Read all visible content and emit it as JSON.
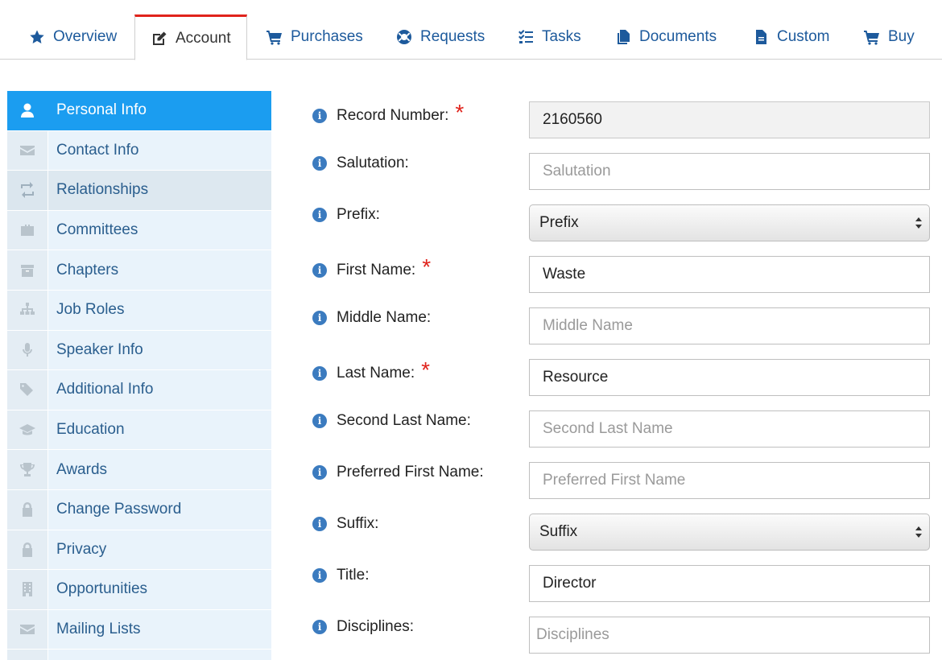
{
  "tabs": [
    {
      "label": "Overview",
      "icon": "star-icon"
    },
    {
      "label": "Account",
      "icon": "edit-icon",
      "active": true
    },
    {
      "label": "Purchases",
      "icon": "cart-icon"
    },
    {
      "label": "Requests",
      "icon": "lifebuoy-icon"
    },
    {
      "label": "Tasks",
      "icon": "tasks-icon"
    },
    {
      "label": "Documents",
      "icon": "documents-icon"
    },
    {
      "label": "Custom",
      "icon": "file-icon"
    },
    {
      "label": "Buy",
      "icon": "cart-icon"
    }
  ],
  "sidebar": {
    "items": [
      {
        "label": "Personal Info",
        "icon": "user-icon",
        "active": true
      },
      {
        "label": "Contact Info",
        "icon": "envelope-icon"
      },
      {
        "label": "Relationships",
        "icon": "retweet-icon",
        "hover": true
      },
      {
        "label": "Committees",
        "icon": "briefcase-icon"
      },
      {
        "label": "Chapters",
        "icon": "archive-icon"
      },
      {
        "label": "Job Roles",
        "icon": "sitemap-icon"
      },
      {
        "label": "Speaker Info",
        "icon": "microphone-icon"
      },
      {
        "label": "Additional Info",
        "icon": "tags-icon"
      },
      {
        "label": "Education",
        "icon": "graduation-cap-icon"
      },
      {
        "label": "Awards",
        "icon": "trophy-icon"
      },
      {
        "label": "Change Password",
        "icon": "lock-icon"
      },
      {
        "label": "Privacy",
        "icon": "lock-icon"
      },
      {
        "label": "Opportunities",
        "icon": "building-icon"
      },
      {
        "label": "Mailing Lists",
        "icon": "envelope-icon"
      }
    ]
  },
  "form": {
    "fields": [
      {
        "label": "Record Number:",
        "required": true,
        "type": "readonly",
        "value": "2160560",
        "placeholder": ""
      },
      {
        "label": "Salutation:",
        "required": false,
        "type": "text",
        "value": "",
        "placeholder": "Salutation"
      },
      {
        "label": "Prefix:",
        "required": false,
        "type": "select",
        "value": "Prefix",
        "placeholder": ""
      },
      {
        "label": "First Name:",
        "required": true,
        "type": "text",
        "value": "Waste",
        "placeholder": ""
      },
      {
        "label": "Middle Name:",
        "required": false,
        "type": "text",
        "value": "",
        "placeholder": "Middle Name"
      },
      {
        "label": "Last Name:",
        "required": true,
        "type": "text",
        "value": "Resource",
        "placeholder": ""
      },
      {
        "label": "Second Last Name:",
        "required": false,
        "type": "text",
        "value": "",
        "placeholder": "Second Last Name"
      },
      {
        "label": "Preferred First Name:",
        "required": false,
        "type": "text",
        "value": "",
        "placeholder": "Preferred First Name"
      },
      {
        "label": "Suffix:",
        "required": false,
        "type": "select",
        "value": "Suffix",
        "placeholder": ""
      },
      {
        "label": "Title:",
        "required": false,
        "type": "text",
        "value": "Director",
        "placeholder": ""
      },
      {
        "label": "Disciplines:",
        "required": false,
        "type": "text",
        "value": "",
        "placeholder": "Disciplines"
      }
    ]
  },
  "colors": {
    "link": "#1d5a9c",
    "active_tab_border": "#e0231c",
    "sidebar_active": "#1b9df0",
    "sidebar_bg": "#e9f3fb",
    "required": "#e0231c",
    "info_icon": "#3b7bbf"
  }
}
